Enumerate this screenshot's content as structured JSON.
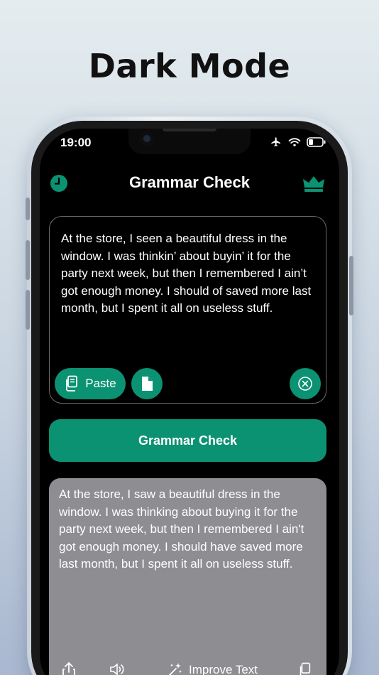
{
  "headline": "Dark Mode",
  "status_bar": {
    "time": "19:00"
  },
  "app": {
    "title": "Grammar Check",
    "input_text": "At the store, I seen a beautiful dress in the window. I was thinkin’ about buyin’ it for the party next week, but then I remembered I ain’t got enough money. I should of saved more last month, but I spent it all on useless stuff.",
    "paste_label": "Paste",
    "check_button_label": "Grammar Check",
    "output_text": "At the store, I saw a beautiful dress in the window. I was thinking about buying it for the party next week, but then I remembered I ain't got enough money. I should have saved more last month, but I spent it all on useless stuff.",
    "improve_label": "Improve Text"
  },
  "icons": {
    "history": "clock-icon",
    "premium": "crown-icon",
    "paste": "clipboard-icon",
    "document": "document-icon",
    "clear": "clear-circle-icon",
    "share": "share-icon",
    "speak": "speaker-icon",
    "improve": "sparkle-wand-icon",
    "copy": "copy-icon"
  },
  "colors": {
    "accent": "#0b9272",
    "screen_bg": "#000000",
    "output_bg": "#8e8d92"
  }
}
